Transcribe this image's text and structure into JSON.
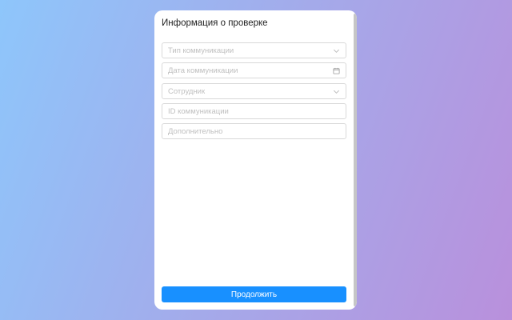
{
  "form": {
    "title": "Информация о проверке",
    "fields": {
      "communication_type": {
        "placeholder": "Тип коммуникации",
        "icon": "chevron-down-icon"
      },
      "communication_date": {
        "placeholder": "Дата коммуникации",
        "icon": "calendar-icon"
      },
      "employee": {
        "placeholder": "Сотрудник",
        "icon": "chevron-down-icon"
      },
      "communication_id": {
        "placeholder": "ID коммуникации",
        "value": ""
      },
      "additional": {
        "placeholder": "Дополнительно",
        "value": ""
      }
    },
    "submit_label": "Продолжить"
  },
  "colors": {
    "accent": "#1890ff",
    "border": "#d9d9d9",
    "placeholder": "#bfbfbf",
    "background_start": "#8ec6fb",
    "background_end": "#b990dc"
  }
}
